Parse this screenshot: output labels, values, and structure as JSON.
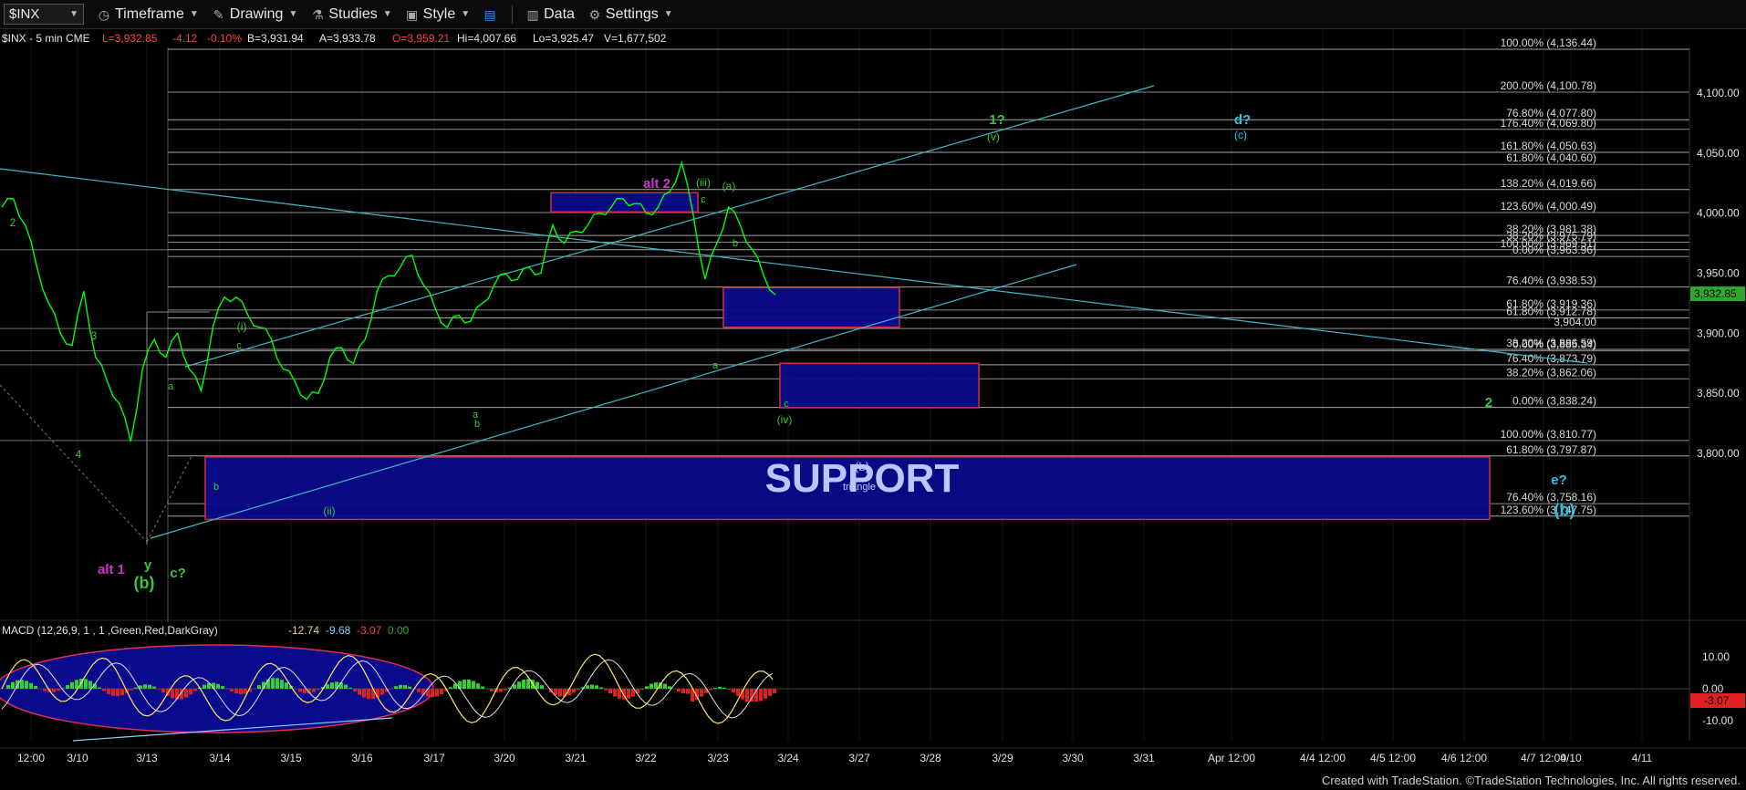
{
  "toolbar": {
    "symbol": "$INX",
    "timeframe": "Timeframe",
    "drawing": "Drawing",
    "studies": "Studies",
    "style": "Style",
    "data": "Data",
    "settings": "Settings"
  },
  "quote": {
    "name": "$INX - 5 min  CME",
    "last": "L=3,932.85",
    "change": "-4.12",
    "pct": "-0.10%",
    "bid": "B=3,931.94",
    "ask": "A=3,933.78",
    "open": "O=3,959.21",
    "hi": "Hi=4,007.66",
    "lo": "Lo=3,925.47",
    "vol": "V=1,677,502"
  },
  "colors": {
    "price": "#00ff00",
    "fib": "#9a9a9a",
    "trend": "#3fb8c6",
    "box": "#0a0a8c",
    "boxBorder": "#e0304a",
    "label": "#39c739",
    "alt": "#cc33cc",
    "cyan": "#2bc4e0"
  },
  "chart_data": {
    "type": "line",
    "title": "$INX - 5 min CME",
    "price_axis": {
      "ticks": [
        "4,100.00",
        "4,050.00",
        "4,000.00",
        "3,950.00",
        "3,900.00",
        "3,850.00",
        "3,800.00"
      ],
      "last_value": "3,932.85",
      "ylim": [
        3745,
        4140
      ]
    },
    "time_axis": [
      "12:00",
      "3/10",
      "3/13",
      "3/14",
      "3/15",
      "3/16",
      "3/17",
      "3/20",
      "3/21",
      "3/22",
      "3/23",
      "3/24",
      "3/27",
      "3/28",
      "3/29",
      "3/30",
      "3/31",
      "Apr 12:00",
      "4/4 12:00",
      "4/5 12:00",
      "4/6 12:00",
      "4/7 12:00",
      "4/10",
      "4/11"
    ],
    "series": [
      {
        "values": [
          4005,
          4012,
          3990,
          3955,
          3925,
          3900,
          3890,
          3935,
          3880,
          3860,
          3842,
          3810,
          3870,
          3895,
          3880,
          3900,
          3870,
          3852,
          3905,
          3930,
          3930,
          3915,
          3905,
          3895,
          3870,
          3860,
          3845,
          3850,
          3880,
          3888,
          3875,
          3895,
          3935,
          3948,
          3955,
          3965,
          3940,
          3920,
          3905,
          3915,
          3910,
          3925,
          3940,
          3950,
          3945,
          3955,
          3950,
          3990,
          3975,
          3985,
          3990,
          4000,
          4005,
          4012,
          4008,
          4000,
          4005,
          4018,
          4042,
          3998,
          3945,
          3975,
          4005,
          3990,
          3970,
          3948,
          3932
        ]
      }
    ],
    "fib_levels": [
      {
        "label": "100.00% (4,136.44)",
        "value": 4136.44
      },
      {
        "label": "200.00% (4,100.78)",
        "value": 4100.78
      },
      {
        "label": "76.80% (4,077.80)",
        "value": 4077.8
      },
      {
        "label": "176.40% (4,069.80)",
        "value": 4069.8
      },
      {
        "label": "161.80% (4,050.63)",
        "value": 4050.63
      },
      {
        "label": "61.80% (4,040.60)",
        "value": 4040.6
      },
      {
        "label": "138.20% (4,019.66)",
        "value": 4019.66
      },
      {
        "label": "123.60% (4,000.49)",
        "value": 4000.49
      },
      {
        "label": "38.20% (3,981.38)",
        "value": 3981.38
      },
      {
        "label": "38.20% (3,975.79)",
        "value": 3975.79
      },
      {
        "label": "100.00% (3,969.51)",
        "value": 3969.51
      },
      {
        "label": "0.00% (3,963.96)",
        "value": 3963.96
      },
      {
        "label": "76.40% (3,938.53)",
        "value": 3938.53
      },
      {
        "label": "61.80% (3,919.36)",
        "value": 3919.36
      },
      {
        "label": "61.80% (3,912.78)",
        "value": 3912.78
      },
      {
        "label": "3,904.00",
        "value": 3904.0
      },
      {
        "label": "38.20% (3,886.59)",
        "value": 3886.59
      },
      {
        "label": "0.00% (3,885.34)",
        "value": 3885.34
      },
      {
        "label": "76.40% (3,873.79)",
        "value": 3873.79
      },
      {
        "label": "38.20% (3,862.06)",
        "value": 3862.06
      },
      {
        "label": "0.00% (3,838.24)",
        "value": 3838.24
      },
      {
        "label": "100.00% (3,810.77)",
        "value": 3810.77
      },
      {
        "label": "61.80% (3,797.87)",
        "value": 3797.87
      },
      {
        "label": "76.40% (3,758.16)",
        "value": 3758.16
      },
      {
        "label": "123.60% (3,747.75)",
        "value": 3747.75
      }
    ],
    "boxes": [
      {
        "text": "",
        "y": [
          4001,
          4017
        ],
        "x_from": "3/20",
        "x_to": "3/23"
      },
      {
        "text": "",
        "y": [
          3905,
          3938
        ],
        "x_from": "3/23",
        "x_to": "3/27"
      },
      {
        "text": "(b) triangle",
        "y": [
          3838,
          3875
        ],
        "x_from": "3/24",
        "x_to": "3/29"
      },
      {
        "text": "SUPPORT",
        "y": [
          3745,
          3797
        ],
        "x_from": "3/13",
        "x_to": "4/6"
      }
    ],
    "wave_labels": [
      "2",
      "3",
      "4",
      "(i)",
      "c",
      "a",
      "b",
      "(ii)",
      "a",
      "b",
      "alt 2",
      "(iii)",
      "(a)",
      "c",
      "b",
      "a",
      "c",
      "(iv)",
      "1?",
      "(v)",
      "d?",
      "(c)",
      "2",
      "e?",
      "(b)",
      "alt 1",
      "(b)",
      "c?",
      "y",
      "(b)",
      "triangle"
    ],
    "macd": {
      "label": "MACD (12,26,9, 1 , 1 ,Green,Red,DarkGray)",
      "macd": "-12.74",
      "signal": "-9.68",
      "hist": "-3.07",
      "zero": "0.00",
      "ticks": [
        "10.00",
        "0.00",
        "-10.00"
      ],
      "last_value": "-3.07"
    }
  },
  "footer": {
    "credit": "Created with TradeStation. ©TradeStation Technologies, Inc. All rights reserved."
  }
}
